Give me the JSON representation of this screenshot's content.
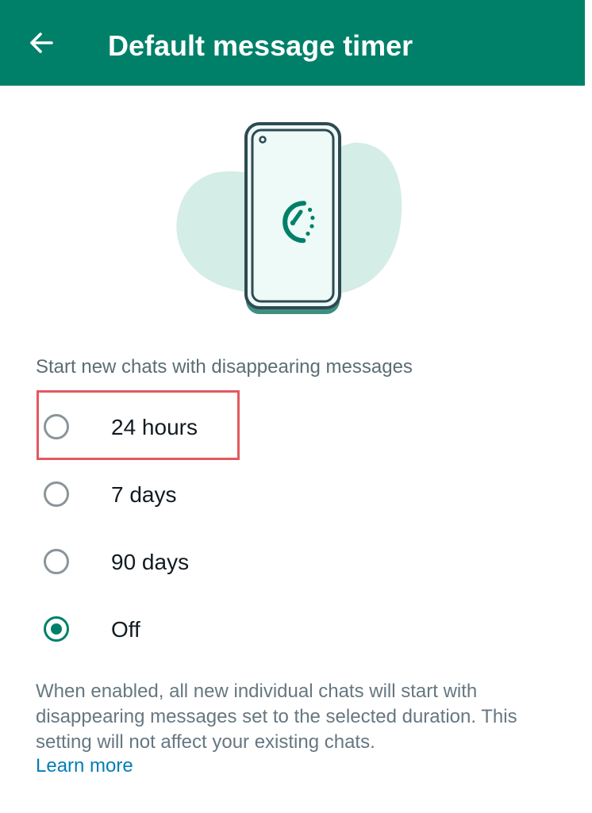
{
  "app_bar": {
    "title": "Default message timer",
    "back_icon": "arrow-left-icon",
    "background_color": "#008069"
  },
  "illustration": {
    "icon": "phone-timer-icon"
  },
  "section": {
    "label": "Start new chats with disappearing messages"
  },
  "options": [
    {
      "label": "24 hours",
      "selected": false,
      "highlighted": true
    },
    {
      "label": "7 days",
      "selected": false,
      "highlighted": false
    },
    {
      "label": "90 days",
      "selected": false,
      "highlighted": false
    },
    {
      "label": "Off",
      "selected": true,
      "highlighted": false
    }
  ],
  "description": {
    "text": "When enabled, all new individual chats will start with disappearing messages set to the selected duration. This setting will not affect your existing chats.",
    "link_label": "Learn more"
  },
  "colors": {
    "accent": "#008069",
    "highlight": "#e4585e",
    "link": "#027eb5"
  }
}
